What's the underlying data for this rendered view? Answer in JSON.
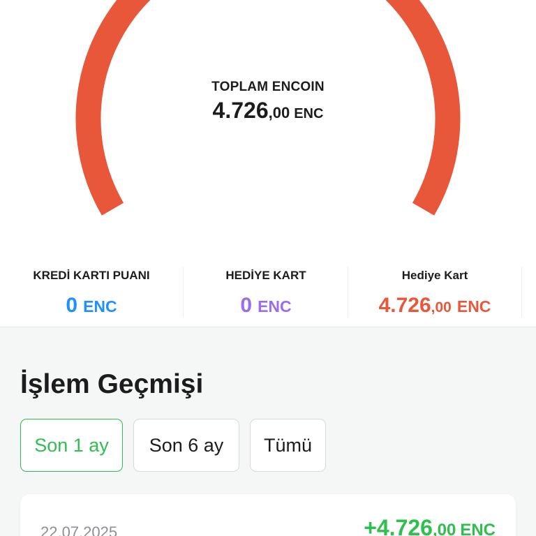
{
  "colors": {
    "gauge_arc": "#e8573a",
    "credit_card_points": "#1e90ff",
    "gift_card_purple": "#9b6cf0",
    "gift_card_orange": "#e8573a",
    "positive_amount": "#2fbf4f",
    "active_filter": "#2fbf4f"
  },
  "gauge": {
    "title": "TOPLAM ENCOIN",
    "value_int": "4.726",
    "value_dec": ",00",
    "unit": "ENC"
  },
  "stats": [
    {
      "label": "KREDİ KARTI PUANI",
      "value_int": "0",
      "value_dec": "",
      "unit": "ENC"
    },
    {
      "label": "HEDİYE KART",
      "value_int": "0",
      "value_dec": "",
      "unit": "ENC"
    },
    {
      "label": "Hediye Kart",
      "value_int": "4.726",
      "value_dec": ",00",
      "unit": "ENC"
    }
  ],
  "history": {
    "title": "İşlem Geçmişi",
    "filters": [
      {
        "label": "Son 1 ay",
        "active": true
      },
      {
        "label": "Son 6 ay",
        "active": false
      },
      {
        "label": "Tümü",
        "active": false
      }
    ],
    "transactions": [
      {
        "date": "22.07.2025",
        "amount_int": "+4.726",
        "amount_dec": ",00",
        "unit": "ENC"
      }
    ]
  }
}
